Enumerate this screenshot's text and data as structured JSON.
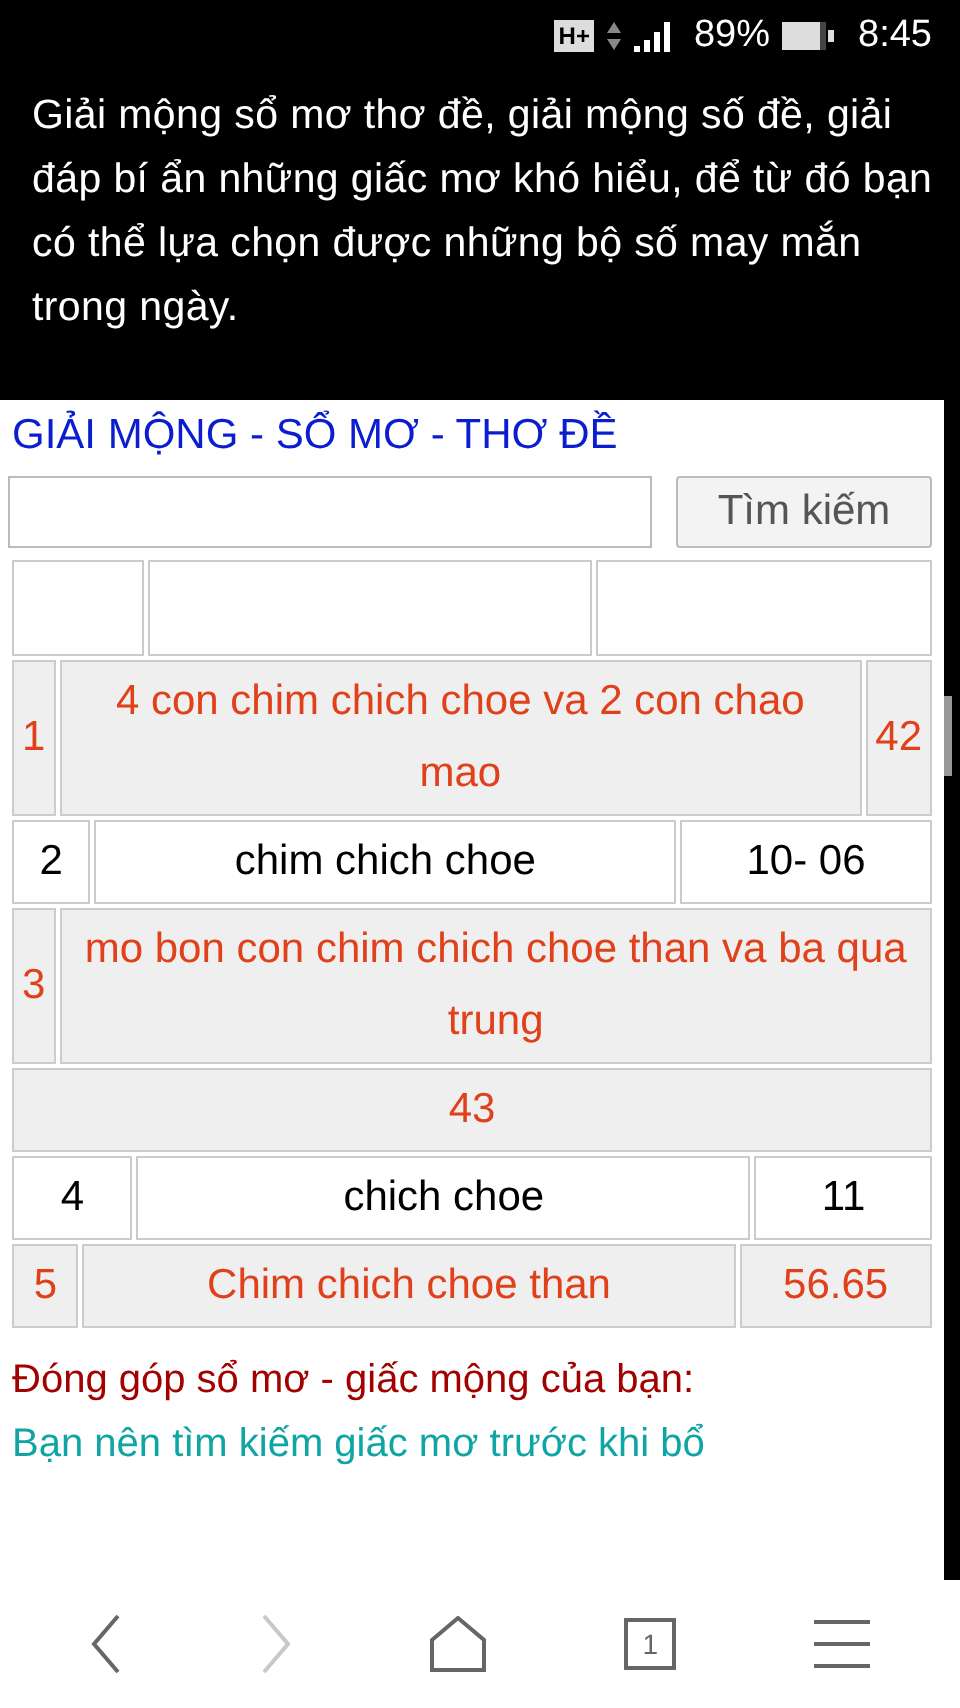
{
  "status_bar": {
    "network": "H+",
    "battery": "89%",
    "time": "8:45"
  },
  "intro": "Giải mộng sổ mơ thơ đề, giải mộng số đề, giải đáp bí ẩn những giấc mơ khó hiểu, để từ đó bạn có thể lựa chọn được những bộ số may mắn trong ngày.",
  "title": "GIẢI MỘNG - SỔ MƠ - THƠ ĐỀ",
  "search": {
    "button": "Tìm kiếm"
  },
  "rows": [
    {
      "highlighted": true,
      "cells": [
        "1",
        "4 con chim chich choe va 2 con chao mao",
        "42"
      ]
    },
    {
      "highlighted": false,
      "cells": [
        "2",
        "chim chich choe",
        "10- 06"
      ]
    },
    {
      "highlighted": true,
      "cells": [
        "3",
        "mo bon con chim chich choe than va ba qua trung"
      ]
    },
    {
      "highlighted": true,
      "cells": [
        "43"
      ]
    },
    {
      "highlighted": false,
      "cells": [
        "4",
        "chich choe",
        "11"
      ]
    },
    {
      "highlighted": true,
      "cells": [
        "5",
        "Chim chich choe than",
        "56.65"
      ]
    }
  ],
  "contribute": {
    "heading": "Đóng góp sổ mơ - giấc mộng của bạn:",
    "text": "Bạn nên tìm kiếm giấc mơ trước khi bổ"
  },
  "nav": {
    "tab_count": "1",
    "forward_disabled": true
  }
}
